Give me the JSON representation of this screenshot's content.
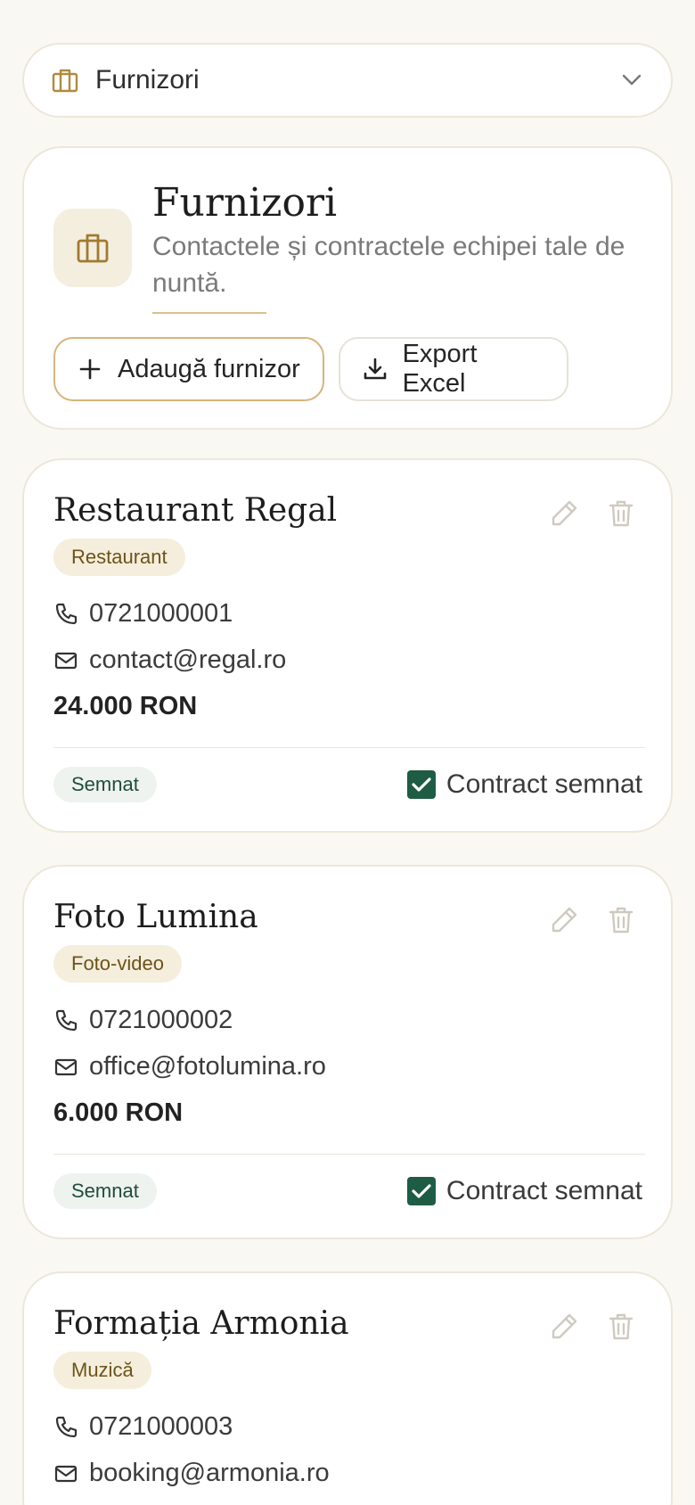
{
  "section_select": {
    "label": "Furnizori"
  },
  "header": {
    "title": "Furnizori",
    "subtitle": "Contactele și contractele echipei tale de nuntă.",
    "add_button": "Adaugă furnizor",
    "export_button": "Export Excel"
  },
  "vendors": [
    {
      "name": "Restaurant Regal",
      "category": "Restaurant",
      "phone": "0721000001",
      "email": "contact@regal.ro",
      "amount": "24.000 RON",
      "status": "Semnat",
      "contract_label": "Contract semnat",
      "contract_signed": true
    },
    {
      "name": "Foto Lumina",
      "category": "Foto-video",
      "phone": "0721000002",
      "email": "office@fotolumina.ro",
      "amount": "6.000 RON",
      "status": "Semnat",
      "contract_label": "Contract semnat",
      "contract_signed": true
    },
    {
      "name": "Formația Armonia",
      "category": "Muzică",
      "phone": "0721000003",
      "email": "booking@armonia.ro",
      "amount": "",
      "status": "",
      "contract_label": "",
      "contract_signed": null
    }
  ],
  "colors": {
    "background": "#faf8f2",
    "accent_gold": "#b08a3e",
    "category_bg": "#f5eedd",
    "status_bg": "#eef3ef",
    "checkbox_green": "#1f5c45"
  },
  "icons": {
    "section": "briefcase-icon",
    "dropdown": "chevron-down-icon",
    "add": "plus-icon",
    "export": "download-icon",
    "phone": "phone-icon",
    "email": "mail-icon",
    "edit": "pencil-icon",
    "delete": "trash-icon",
    "check": "check-icon"
  }
}
